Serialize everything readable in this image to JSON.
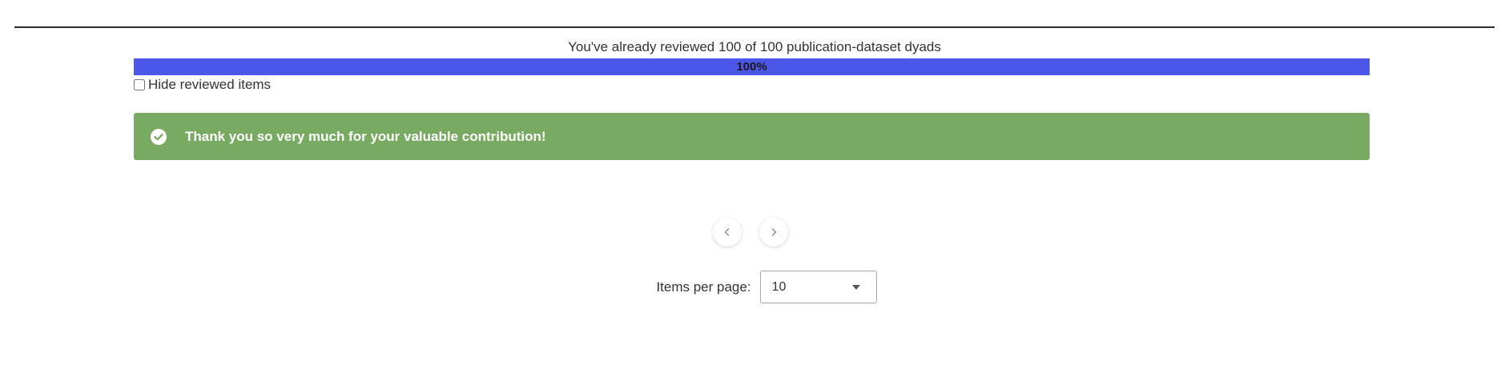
{
  "progress": {
    "caption": "You've already reviewed 100 of 100 publication-dataset dyads",
    "reviewed": 100,
    "total": 100,
    "percent_label": "100%",
    "fill_fraction": 1.0,
    "fill_color": "#4b57e8"
  },
  "filters": {
    "hide_reviewed_label": "Hide reviewed items",
    "hide_reviewed_checked": false
  },
  "banner": {
    "message": "Thank you so very much for your valuable contribution!",
    "icon": "check-circle-icon",
    "color": "#78aa62"
  },
  "pagination": {
    "prev_icon": "chevron-left-icon",
    "next_icon": "chevron-right-icon",
    "items_per_page_label": "Items per page:",
    "items_per_page_value": "10"
  }
}
